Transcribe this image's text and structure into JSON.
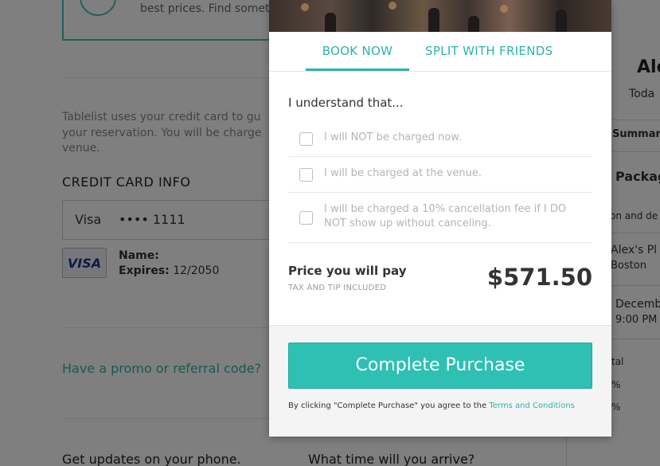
{
  "background": {
    "banner_text": [
      "best prices. Find someti"
    ],
    "intro_text": "Tablelist uses your credit card to gu your reservation. You will be charge venue.",
    "credit_card": {
      "title": "CREDIT CARD INFO",
      "brand": "Visa",
      "number_masked": "•••• 1111",
      "card_logo": "VISA",
      "name_label": "Name:",
      "expires_label": "Expires:",
      "expires_value": "12/2050"
    },
    "promo_link": "Have a promo or referral code?",
    "updates_label": "Get updates on your phone.",
    "arrive_label": "What time will you arrive?",
    "summary": {
      "title": "Ale",
      "subtitle": "Toda",
      "summary_label": "Summary",
      "package_label": "Package",
      "details_label": "on and de",
      "venue_name": "Alex's Pl",
      "venue_city": "Boston",
      "date_label": "Decemb",
      "time_label": "9:00 PM",
      "row_total": "tal",
      "row_pct1": "%",
      "row_pct2": "%"
    }
  },
  "modal": {
    "tabs": [
      {
        "label": "BOOK NOW",
        "active": true
      },
      {
        "label": "SPLIT WITH FRIENDS",
        "active": false
      }
    ],
    "understand_heading": "I understand that...",
    "checklist": [
      {
        "label": "I will NOT be charged now.",
        "checked": false
      },
      {
        "label": "I will be charged at the venue.",
        "checked": false
      },
      {
        "label": "I will be charged a 10% cancellation fee if I DO NOT show up without canceling.",
        "checked": false
      }
    ],
    "price": {
      "label": "Price you will pay",
      "note": "TAX AND TIP INCLUDED",
      "value": "$571.50"
    },
    "complete_button": "Complete Purchase",
    "terms_prefix": "By clicking \"Complete Purchase\" you agree to the",
    "terms_link": "Terms and Conditions"
  },
  "colors": {
    "accent": "#2eb3a9",
    "button": "#2ec0b2",
    "overlay": "rgba(0,0,0,0.5)"
  }
}
